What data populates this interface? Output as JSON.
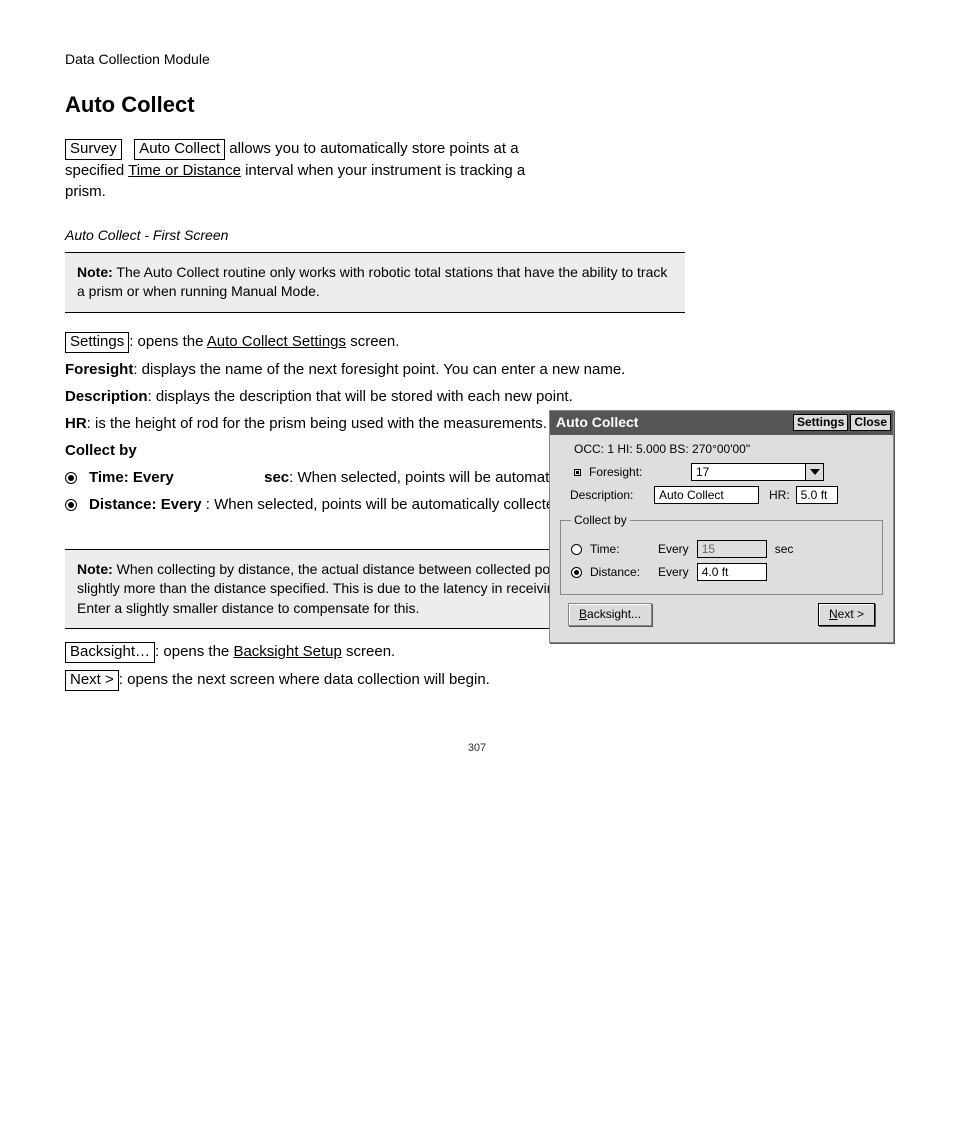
{
  "breadcrumb": "Data Collection Module",
  "section_title": "Auto Collect",
  "intro_1_pre": "",
  "buttons": {
    "survey": "Survey",
    "auto_collect": "Auto Collect",
    "settings": "Settings",
    "backsight_ref": "Backsight…",
    "next_ref": "Next >"
  },
  "intro_line": " allows you to automatically store points at a ",
  "intro_line2": "specified ",
  "intro_underline": "Time or Distance",
  "intro_line3": " interval when your instrument is tracking a ",
  "intro_line4": "prism.",
  "first_screen_heading": "Auto Collect - First Screen",
  "note1": {
    "label": "Note:",
    "text": " The Auto Collect routine only works with robotic total stations that have the ability to track a prism or when running Manual Mode."
  },
  "settings_line_a": ": opens the ",
  "settings_link": "Auto Collect Settings",
  "settings_line_b": " screen.",
  "foresight_label": "Foresight",
  "foresight_text": ": displays the name of the next foresight point. You can enter a new name.",
  "description_label": "Description",
  "description_text": ": displays the description that will be stored with each new point.",
  "hr_label": "HR",
  "hr_text": ": is the height of rod for the prism being used with the measurements.",
  "collect_by_label": "Collect by",
  "time_label": "Time: Every",
  "time_suffix": "sec",
  "time_text": ": When selected, points will be automatically collected at the time interval specified.",
  "distance_label": "Distance: Every",
  "distance_text": ": When selected, points will be automatically collected at the distance interval specified.",
  "note2": {
    "label": "Note:",
    "text": " When collecting by distance, the actual distance between collected points will often be slightly more than the distance specified. This is due to the latency in receiving the shot data. Enter a slightly smaller distance to compensate for this."
  },
  "backsight_line_a": ": opens the ",
  "backsight_link": "Backsight Setup",
  "backsight_line_b": " screen.",
  "next_line": ": opens the next screen where data collection will begin.",
  "dialog": {
    "title": "Auto Collect",
    "settings_btn": "Settings",
    "close_btn": "Close",
    "status": "OCC: 1  HI: 5.000  BS: 270°00'00\"",
    "foresight_label": "Foresight:",
    "foresight_value": "17",
    "description_label": "Description:",
    "description_value": "Auto Collect",
    "hr_label": "HR:",
    "hr_value": "5.0 ft",
    "collect_by_legend": "Collect by",
    "time_label": "Time:",
    "every_label": "Every",
    "time_value": "15",
    "time_suffix": "sec",
    "distance_label": "Distance:",
    "distance_value": "4.0 ft",
    "backsight_btn": "Backsight...",
    "next_btn": "Next >",
    "next_underline_char": "N",
    "backsight_underline_char": "B"
  },
  "footer": "307"
}
